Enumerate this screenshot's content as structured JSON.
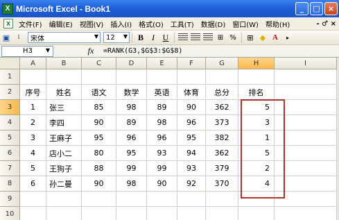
{
  "window": {
    "title": "Microsoft Excel - Book1",
    "app_icon": "X",
    "buttons": [
      "_",
      "□",
      "×"
    ]
  },
  "menu": {
    "items": [
      "文件(F)",
      "编辑(E)",
      "视图(V)",
      "插入(I)",
      "格式(O)",
      "工具(T)",
      "数据(D)",
      "窗口(W)",
      "帮助(H)"
    ],
    "tail": "- ♂ ×"
  },
  "toolbar": {
    "font_name": "宋体",
    "font_size": "12",
    "bold": "B",
    "italic": "I",
    "underline": "U"
  },
  "formula_bar": {
    "name_box": "H3",
    "fx": "fx",
    "formula": "=RANK(G3,$G$3:$G$8)"
  },
  "columns": [
    "A",
    "B",
    "C",
    "D",
    "E",
    "F",
    "G",
    "H",
    "I"
  ],
  "rows": [
    "1",
    "2",
    "3",
    "4",
    "5",
    "6",
    "7",
    "8",
    "9",
    "10"
  ],
  "table": {
    "headers": [
      "序号",
      "姓名",
      "语文",
      "数学",
      "英语",
      "体育",
      "总分",
      "排名"
    ],
    "rows": [
      [
        "1",
        "张三",
        "85",
        "98",
        "89",
        "90",
        "362",
        "5"
      ],
      [
        "2",
        "李四",
        "90",
        "89",
        "98",
        "96",
        "373",
        "3"
      ],
      [
        "3",
        "王麻子",
        "95",
        "96",
        "96",
        "95",
        "382",
        "1"
      ],
      [
        "4",
        "店小二",
        "80",
        "95",
        "93",
        "94",
        "362",
        "5"
      ],
      [
        "5",
        "王狗子",
        "88",
        "99",
        "99",
        "93",
        "379",
        "2"
      ],
      [
        "6",
        "孙二曼",
        "90",
        "98",
        "90",
        "92",
        "370",
        "4"
      ]
    ]
  },
  "colors": {
    "title_bar": "#2461d8",
    "highlight_border": "#b0322a",
    "active_header": "#f5b94a"
  }
}
